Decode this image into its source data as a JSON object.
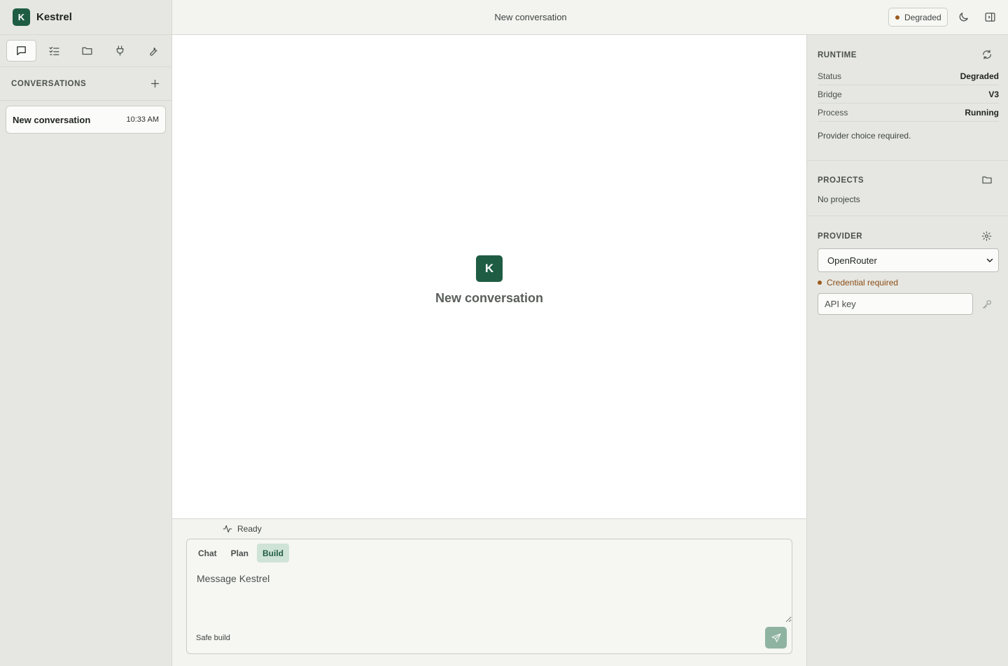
{
  "app": {
    "name": "Kestrel",
    "logo_letter": "K"
  },
  "sidebar": {
    "tabs": [
      {
        "icon": "chat-icon",
        "active": true
      },
      {
        "icon": "checklist-icon",
        "active": false
      },
      {
        "icon": "folder-icon",
        "active": false
      },
      {
        "icon": "plug-icon",
        "active": false
      },
      {
        "icon": "wrench-icon",
        "active": false
      }
    ],
    "section_title": "CONVERSATIONS",
    "conversations": [
      {
        "name": "New conversation",
        "time": "10:33 AM"
      }
    ]
  },
  "header": {
    "title": "New conversation",
    "status": "Degraded",
    "status_color": "#9a5a1c"
  },
  "main": {
    "hero_logo": "K",
    "hero_title": "New conversation"
  },
  "composer": {
    "status": "Ready",
    "modes": [
      {
        "label": "Chat",
        "active": false
      },
      {
        "label": "Plan",
        "active": false
      },
      {
        "label": "Build",
        "active": true
      }
    ],
    "placeholder": "Message Kestrel",
    "footer_label": "Safe build"
  },
  "runtime": {
    "title": "RUNTIME",
    "rows": [
      {
        "key": "Status",
        "value": "Degraded"
      },
      {
        "key": "Bridge",
        "value": "V3"
      },
      {
        "key": "Process",
        "value": "Running"
      }
    ],
    "note": "Provider choice required."
  },
  "projects": {
    "title": "PROJECTS",
    "empty": "No projects"
  },
  "provider": {
    "title": "PROVIDER",
    "selected": "OpenRouter",
    "credential_status": "Credential required",
    "credential_color": "#9a5a1c",
    "api_key_placeholder": "API key"
  },
  "colors": {
    "accent": "#1f5c44",
    "accent_soft": "#cfe3d6",
    "warning": "#9a5a1c"
  }
}
